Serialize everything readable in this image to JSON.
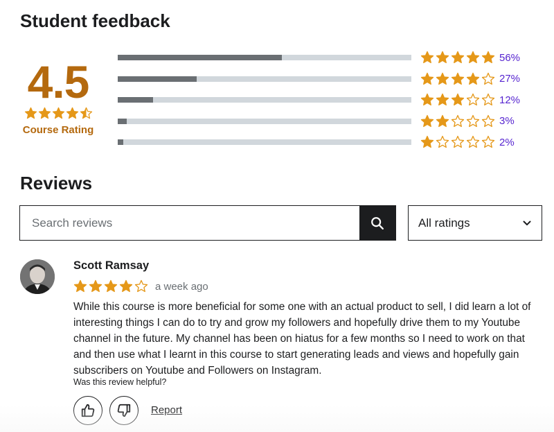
{
  "colors": {
    "star": "#e59819",
    "rating_text": "#b4690e",
    "percent_text": "#5624d0",
    "bar_fill": "#6a6f73",
    "bar_track": "#d1d7dc"
  },
  "feedback": {
    "title": "Student feedback",
    "average": "4.5",
    "average_value": 4.5,
    "rating_label": "Course Rating",
    "distribution": [
      {
        "stars": 5,
        "percent": 56,
        "percent_label": "56%"
      },
      {
        "stars": 4,
        "percent": 27,
        "percent_label": "27%"
      },
      {
        "stars": 3,
        "percent": 12,
        "percent_label": "12%"
      },
      {
        "stars": 2,
        "percent": 3,
        "percent_label": "3%"
      },
      {
        "stars": 1,
        "percent": 2,
        "percent_label": "2%"
      }
    ]
  },
  "reviews": {
    "title": "Reviews",
    "search_placeholder": "Search reviews",
    "search_icon": "search-icon",
    "filter_label": "All ratings",
    "filter_icon": "chevron-down-icon",
    "items": [
      {
        "name": "Scott Ramsay",
        "rating": 4,
        "date": "a week ago",
        "body": "While this course is more beneficial for some one with an actual product to sell, I did learn a lot of interesting things I can do to try and grow my followers and hopefully drive them to my Youtube channel in the future. My channel has been on hiatus for a few months so I need to work on that and then use what I learnt in this course to start generating leads and views and hopefully gain subscribers on Youtube and Followers on Instagram.",
        "helpful_prompt": "Was this review helpful?",
        "report_label": "Report"
      }
    ]
  }
}
